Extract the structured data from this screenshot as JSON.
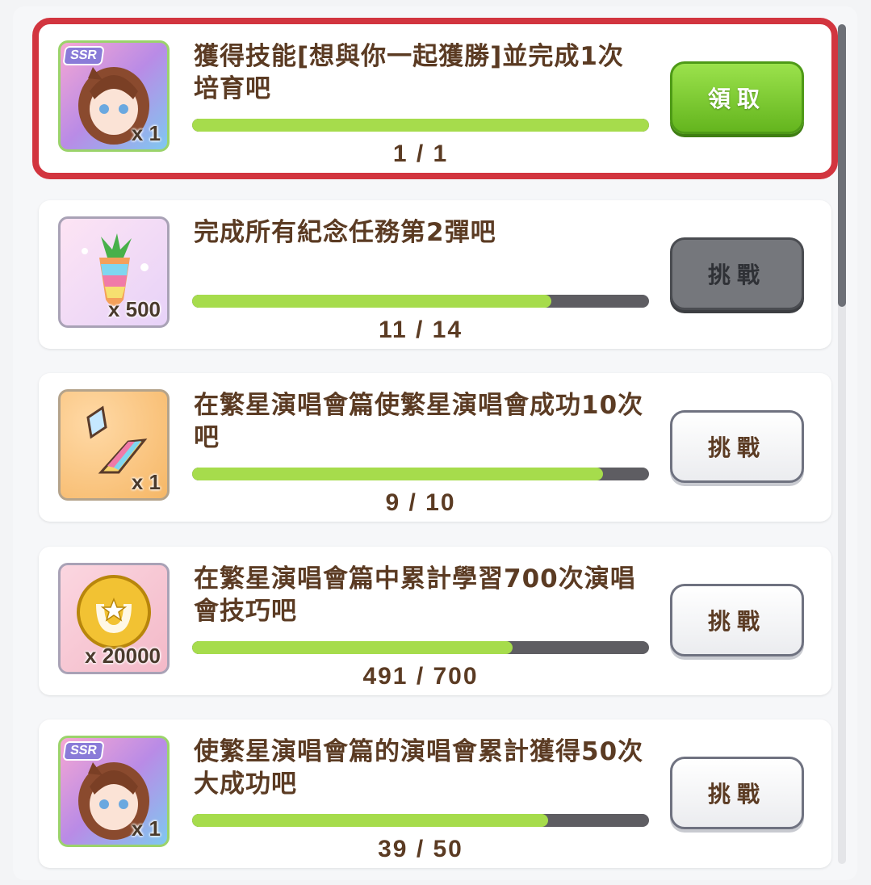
{
  "missions": [
    {
      "title": "獲得技能[想與你一起獲勝]並完成1次培育吧",
      "reward_icon": "ssr-support-card",
      "reward_badge": "SSR",
      "reward_qty": "x 1",
      "current": 1,
      "total": 1,
      "progress_text": "1 / 1",
      "button_label": "領取",
      "button_state": "claim",
      "highlighted": true
    },
    {
      "title": "完成所有紀念任務第2彈吧",
      "reward_icon": "rainbow-carrot-icon",
      "reward_badge": "",
      "reward_qty": "x 500",
      "current": 11,
      "total": 14,
      "progress_text": "11 / 14",
      "button_label": "挑戰",
      "button_state": "disabled",
      "highlighted": false
    },
    {
      "title": "在繁星演唱會篇使繁星演唱會成功10次吧",
      "reward_icon": "rainbow-crystal-icon",
      "reward_badge": "",
      "reward_qty": "x 1",
      "current": 9,
      "total": 10,
      "progress_text": "9 / 10",
      "button_label": "挑戰",
      "button_state": "normal",
      "highlighted": false
    },
    {
      "title": "在繁星演唱會篇中累計學習700次演唱會技巧吧",
      "reward_icon": "gold-horseshoe-coin-icon",
      "reward_badge": "",
      "reward_qty": "x 20000",
      "current": 491,
      "total": 700,
      "progress_text": "491 / 700",
      "button_label": "挑戰",
      "button_state": "normal",
      "highlighted": false
    },
    {
      "title": "使繁星演唱會篇的演唱會累計獲得50次大成功吧",
      "reward_icon": "ssr-support-card",
      "reward_badge": "SSR",
      "reward_qty": "x 1",
      "current": 39,
      "total": 50,
      "progress_text": "39 / 50",
      "button_label": "挑戰",
      "button_state": "normal",
      "highlighted": false
    }
  ],
  "colors": {
    "highlight": "#d2353f",
    "progress_fill": "#a6dc4c",
    "progress_track": "#5e5d62",
    "text": "#5b3b23",
    "claim_button": "#7cc733"
  }
}
